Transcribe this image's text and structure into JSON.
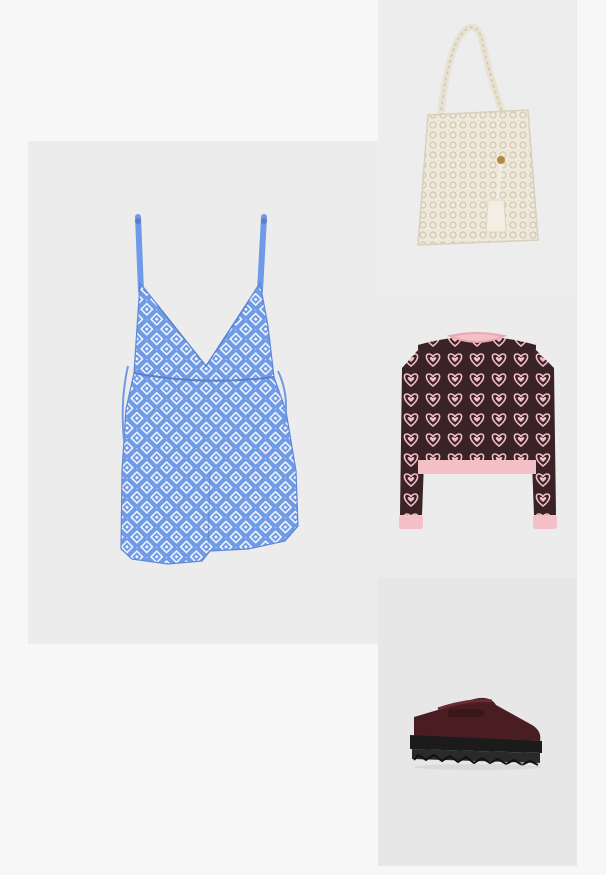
{
  "outfit": {
    "items": [
      {
        "icon": "romper-image",
        "colors": [
          "#6f9ae6",
          "#ffffff"
        ]
      },
      {
        "icon": "tote-bag-image",
        "colors": [
          "#efe9dc",
          "#d8cfbd"
        ]
      },
      {
        "icon": "sweater-image",
        "colors": [
          "#f3c0c8",
          "#3a2327"
        ]
      },
      {
        "icon": "loafer-image",
        "colors": [
          "#4a1d22",
          "#1b1b1b"
        ]
      }
    ]
  }
}
